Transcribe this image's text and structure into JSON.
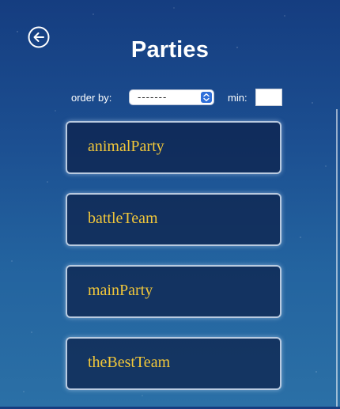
{
  "header": {
    "title": "Parties",
    "back_icon": "arrow-left-circle-icon"
  },
  "filters": {
    "order_label": "order by:",
    "order_value": "-------",
    "min_label": "min:",
    "min_value": ""
  },
  "parties": [
    {
      "name": "animalParty"
    },
    {
      "name": "battleTeam"
    },
    {
      "name": "mainParty"
    },
    {
      "name": "theBestTeam"
    }
  ],
  "colors": {
    "party_name": "#f0c63a",
    "card_fill": "#0c2048",
    "select_stepper": "#2f6fd9",
    "title": "#ffffff"
  }
}
